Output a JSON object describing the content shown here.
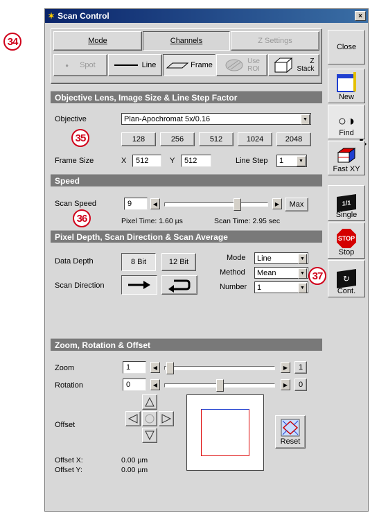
{
  "callouts": {
    "c34": "34",
    "c35": "35",
    "c36": "36",
    "c37": "37"
  },
  "window": {
    "title": "Scan Control",
    "close": "×"
  },
  "tabs": {
    "mode": "Mode",
    "channels": "Channels",
    "zsettings": "Z Settings"
  },
  "scanmodes": {
    "spot": "Spot",
    "line": "Line",
    "frame": "Frame",
    "useroi_1": "Use",
    "useroi_2": "ROI",
    "zstack_1": "Z",
    "zstack_2": "Stack"
  },
  "objective_section": {
    "title": "Objective Lens, Image Size & Line Step Factor",
    "objective_label": "Objective",
    "objective_value": "Plan-Apochromat 5x/0.16",
    "sizes": [
      "128",
      "256",
      "512",
      "1024",
      "2048"
    ],
    "frame_size_label": "Frame Size",
    "x_label": "X",
    "x_value": "512",
    "y_label": "Y",
    "y_value": "512",
    "line_step_label": "Line Step",
    "line_step_value": "1"
  },
  "speed_section": {
    "title": "Speed",
    "scan_speed_label": "Scan Speed",
    "scan_speed_value": "9",
    "slider_fraction": 0.72,
    "max_label": "Max",
    "pixel_time": "Pixel Time:  1.60 µs",
    "scan_time": "Scan Time:  2.95 sec"
  },
  "depth_section": {
    "title": "Pixel Depth, Scan Direction & Scan Average",
    "data_depth_label": "Data Depth",
    "bit8": "8 Bit",
    "bit12": "12 Bit",
    "scan_direction_label": "Scan Direction",
    "mode_label": "Mode",
    "mode_value": "Line",
    "method_label": "Method",
    "method_value": "Mean",
    "number_label": "Number",
    "number_value": "1"
  },
  "zoom_section": {
    "title": "Zoom, Rotation & Offset",
    "zoom_label": "Zoom",
    "zoom_value": "1",
    "zoom_fraction": 0.02,
    "zoom_btn": "1",
    "rotation_label": "Rotation",
    "rotation_value": "0",
    "rotation_fraction": 0.5,
    "rotation_btn": "0",
    "offset_label": "Offset",
    "offset_x_label": "Offset X:",
    "offset_x_value": "0.00 µm",
    "offset_y_label": "Offset Y:",
    "offset_y_value": "0.00 µm",
    "reset_label": "Reset"
  },
  "side": {
    "close": "Close",
    "new": "New",
    "find": "Find",
    "fastxy": "Fast XY",
    "single": "Single",
    "single_icon": "1/1",
    "stop": "Stop",
    "stop_icon": "STOP",
    "cont": "Cont."
  },
  "colors": {
    "title_bar": "#0a246a",
    "section_header": "#797979",
    "callout": "#d0021b",
    "stop_red": "#d40000"
  }
}
